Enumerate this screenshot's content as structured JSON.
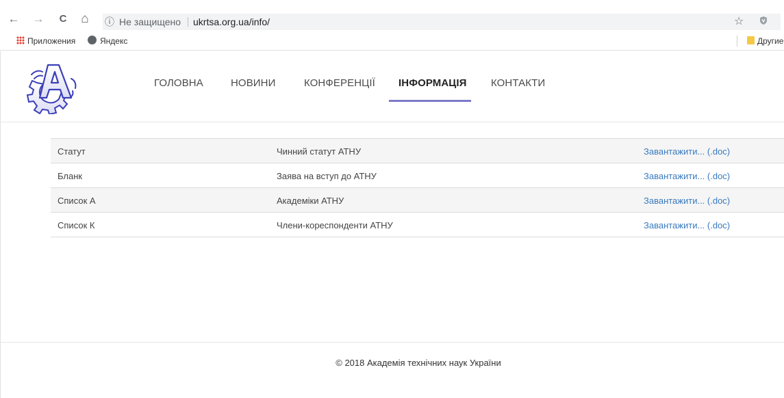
{
  "browser": {
    "back_icon": "←",
    "forward_icon": "→",
    "reload_icon": "C",
    "home_icon": "⌂",
    "info_icon": "ⓘ",
    "security_text": "Не защищено",
    "url": "ukrtsa.org.ua/info/",
    "star_icon": "☆",
    "shield_icon": "🛡"
  },
  "bookmarks": {
    "apps_label": "Приложения",
    "yandex_label": "Яндекс",
    "other_label": "Другие"
  },
  "site": {
    "menu": [
      {
        "label": "ГОЛОВНА"
      },
      {
        "label": "НОВИНИ"
      },
      {
        "label": "КОНФЕРЕНЦІЇ"
      },
      {
        "label": "ІНФОРМАЦІЯ",
        "active": true
      },
      {
        "label": "КОНТАКТИ"
      }
    ],
    "accent_color": "#7c79c9",
    "link_color": "#3a7abf"
  },
  "table": {
    "rows": [
      {
        "name": "Статут",
        "description": "Чинний статут АТНУ",
        "link": "Завантажити... (.doc)"
      },
      {
        "name": "Бланк",
        "description": "Заява на вступ до АТНУ",
        "link": "Завантажити... (.doc)"
      },
      {
        "name": "Список А",
        "description": "Академіки АТНУ",
        "link": "Завантажити... (.doc)"
      },
      {
        "name": "Список К",
        "description": "Члени-кореспонденти АТНУ",
        "link": "Завантажити... (.doc)"
      }
    ]
  },
  "footer": {
    "copyright": "© 2018 Академія технічних наук України"
  }
}
